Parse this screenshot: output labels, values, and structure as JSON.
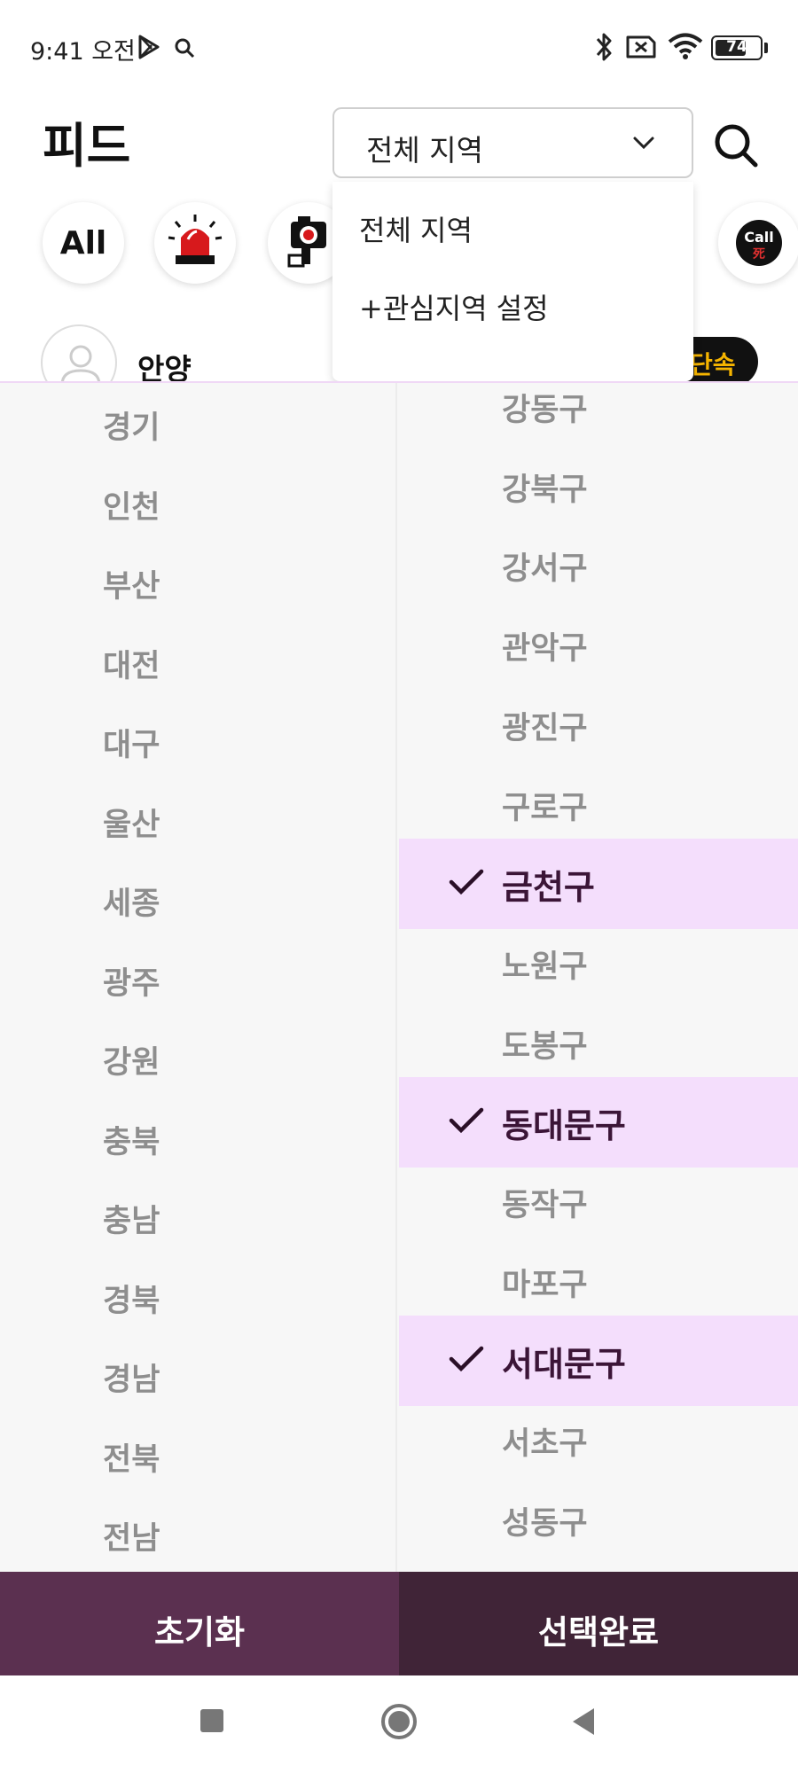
{
  "status": {
    "time": "9:41 오전",
    "battery": "74",
    "battery_level": 0.74
  },
  "header": {
    "title": "피드",
    "region_selected": "전체 지역"
  },
  "dropdown": {
    "items": [
      "전체 지역",
      "+관심지역 설정"
    ]
  },
  "categories": {
    "all_label": "All",
    "call_label": "Call",
    "call_sub": "死"
  },
  "post": {
    "author": "안양",
    "tag": "단속"
  },
  "regions": {
    "provinces": [
      "경기",
      "인천",
      "부산",
      "대전",
      "대구",
      "울산",
      "세종",
      "광주",
      "강원",
      "충북",
      "충남",
      "경북",
      "경남",
      "전북",
      "전남"
    ],
    "districts": [
      {
        "name": "강동구",
        "selected": false
      },
      {
        "name": "강북구",
        "selected": false
      },
      {
        "name": "강서구",
        "selected": false
      },
      {
        "name": "관악구",
        "selected": false
      },
      {
        "name": "광진구",
        "selected": false
      },
      {
        "name": "구로구",
        "selected": false
      },
      {
        "name": "금천구",
        "selected": true
      },
      {
        "name": "노원구",
        "selected": false
      },
      {
        "name": "도봉구",
        "selected": false
      },
      {
        "name": "동대문구",
        "selected": true
      },
      {
        "name": "동작구",
        "selected": false
      },
      {
        "name": "마포구",
        "selected": false
      },
      {
        "name": "서대문구",
        "selected": true
      },
      {
        "name": "서초구",
        "selected": false
      },
      {
        "name": "성동구",
        "selected": false
      }
    ]
  },
  "buttons": {
    "reset": "초기화",
    "done": "선택완료"
  },
  "colors": {
    "selected_bg": "#f4defc",
    "reset_bg": "#5b3050",
    "done_bg": "#402437",
    "tag_text": "#f5b400"
  }
}
